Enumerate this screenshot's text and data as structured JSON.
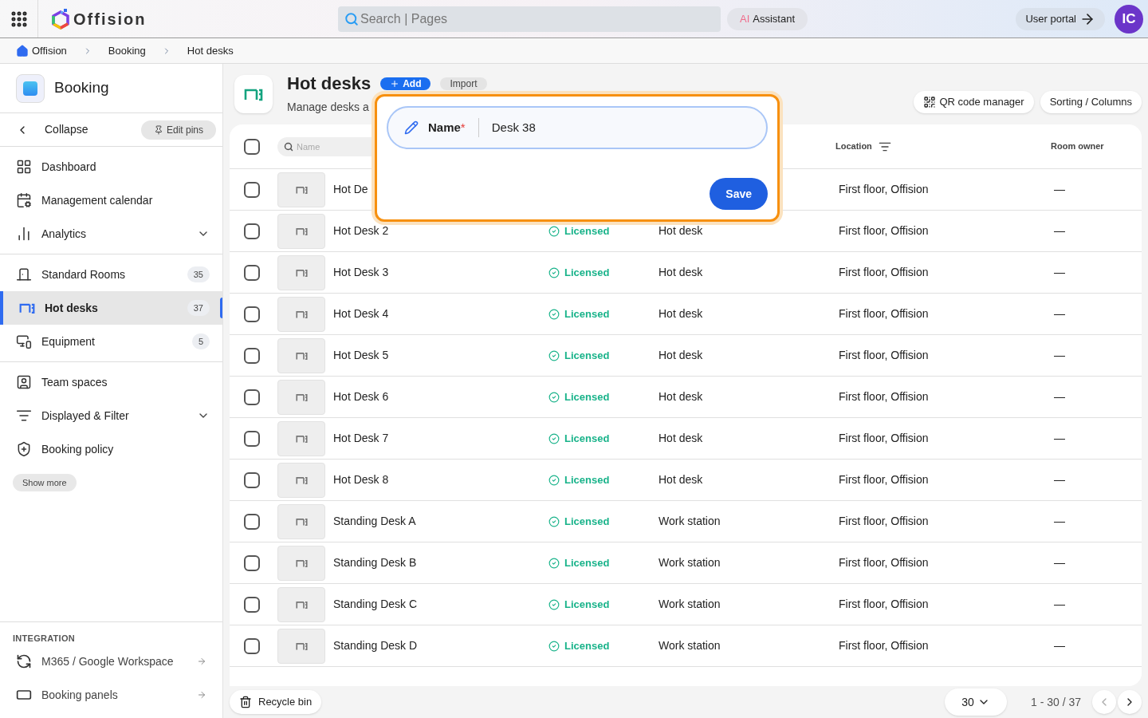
{
  "topbar": {
    "brand": "Offision",
    "search": {
      "placeholder": "Search | Pages"
    },
    "assistant": {
      "badge": "AI",
      "label": "Assistant"
    },
    "user_portal": "User portal",
    "avatar": "IC"
  },
  "breadcrumbs": [
    "Offision",
    "Booking",
    "Hot desks"
  ],
  "sidebar": {
    "title": "Booking",
    "collapse": "Collapse",
    "edit_pins": "Edit pins",
    "groups": [
      [
        {
          "label": "Dashboard",
          "selected": false
        },
        {
          "label": "Management calendar",
          "selected": false
        },
        {
          "label": "Analytics",
          "selected": false,
          "expanded": false
        }
      ],
      [
        {
          "label": "Standard Rooms",
          "selected": false,
          "count": "35"
        },
        {
          "label": "Hot desks",
          "selected": true,
          "count": "37"
        },
        {
          "label": "Equipment",
          "selected": false,
          "count": "5"
        }
      ],
      [
        {
          "label": "Team spaces",
          "selected": false
        },
        {
          "label": "Displayed & Filter",
          "selected": false,
          "expanded": false
        },
        {
          "label": "Booking policy",
          "selected": false
        }
      ]
    ],
    "show_more": "Show more",
    "integration": {
      "heading": "INTEGRATION",
      "items": [
        "M365 / Google Workspace",
        "Booking panels"
      ]
    }
  },
  "page": {
    "title": "Hot desks",
    "subtitle": "Manage desks a",
    "add": "Add",
    "import": "Import",
    "qr": "QR code manager",
    "sorting": "Sorting / Columns"
  },
  "table": {
    "select_all": {
      "checked": false
    },
    "search": {
      "placeholder": "Name"
    },
    "columns": [
      "Location",
      "Room owner"
    ],
    "rows": [
      {
        "checked": false,
        "name": "Hot De",
        "location": "First floor, Offision",
        "owner": "—"
      },
      {
        "checked": false,
        "name": "Hot Desk 2",
        "status": "Licensed",
        "type": "Hot desk",
        "location": "First floor, Offision",
        "owner": "—"
      },
      {
        "checked": false,
        "name": "Hot Desk 3",
        "status": "Licensed",
        "type": "Hot desk",
        "location": "First floor, Offision",
        "owner": "—"
      },
      {
        "checked": false,
        "name": "Hot Desk 4",
        "status": "Licensed",
        "type": "Hot desk",
        "location": "First floor, Offision",
        "owner": "—"
      },
      {
        "checked": false,
        "name": "Hot Desk 5",
        "status": "Licensed",
        "type": "Hot desk",
        "location": "First floor, Offision",
        "owner": "—"
      },
      {
        "checked": false,
        "name": "Hot Desk 6",
        "status": "Licensed",
        "type": "Hot desk",
        "location": "First floor, Offision",
        "owner": "—"
      },
      {
        "checked": false,
        "name": "Hot Desk 7",
        "status": "Licensed",
        "type": "Hot desk",
        "location": "First floor, Offision",
        "owner": "—"
      },
      {
        "checked": false,
        "name": "Hot Desk 8",
        "status": "Licensed",
        "type": "Hot desk",
        "location": "First floor, Offision",
        "owner": "—"
      },
      {
        "checked": false,
        "name": "Standing Desk A",
        "status": "Licensed",
        "type": "Work station",
        "location": "First floor, Offision",
        "owner": "—"
      },
      {
        "checked": false,
        "name": "Standing Desk B",
        "status": "Licensed",
        "type": "Work station",
        "location": "First floor, Offision",
        "owner": "—"
      },
      {
        "checked": false,
        "name": "Standing Desk C",
        "status": "Licensed",
        "type": "Work station",
        "location": "First floor, Offision",
        "owner": "—"
      },
      {
        "checked": false,
        "name": "Standing Desk D",
        "status": "Licensed",
        "type": "Work station",
        "location": "First floor, Offision",
        "owner": "—"
      }
    ]
  },
  "popover": {
    "label": "Name",
    "required_mark": "*",
    "value": "Desk 38",
    "save": "Save"
  },
  "footer": {
    "recycle_bin": "Recycle bin",
    "page_size": "30",
    "range": "1 - 30 / 37"
  }
}
